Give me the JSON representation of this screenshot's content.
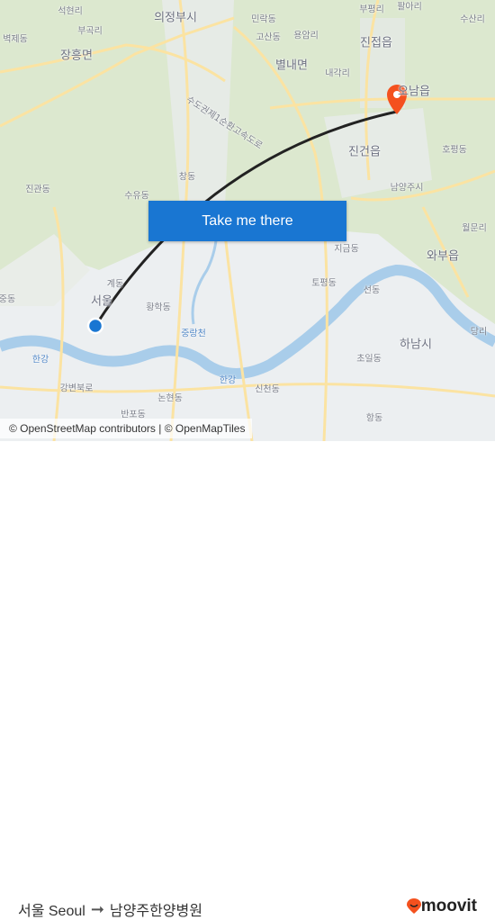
{
  "map": {
    "labels": [
      "석현리",
      "의정부시",
      "민락동",
      "부평리",
      "팔아리",
      "수산리",
      "벽제동",
      "부곡리",
      "고산동",
      "용암리",
      "진접읍",
      "장흥면",
      "별내면",
      "내각리",
      "오남읍",
      "수도권제1순환고속도로",
      "진건읍",
      "호평동",
      "창동",
      "진관동",
      "수유동",
      "남양주시",
      "지금동",
      "와부읍",
      "월문리",
      "계동",
      "서울",
      "토평동",
      "선동",
      "황학동",
      "중랑천",
      "하남시",
      "초일동",
      "한강",
      "한강",
      "신천동",
      "강변북로",
      "논현동",
      "반포동",
      "항동",
      "중동",
      "당리"
    ],
    "origin_marker_color": "#1976d2",
    "destination_marker_color": "#f4511e",
    "route_color": "#222222"
  },
  "cta": {
    "label": "Take me there"
  },
  "attribution": "© OpenStreetMap contributors | © OpenMapTiles",
  "footer": {
    "origin": "서울 Seoul",
    "destination": "남양주한양병원",
    "brand": "moovit",
    "brand_color": "#f4511e"
  }
}
